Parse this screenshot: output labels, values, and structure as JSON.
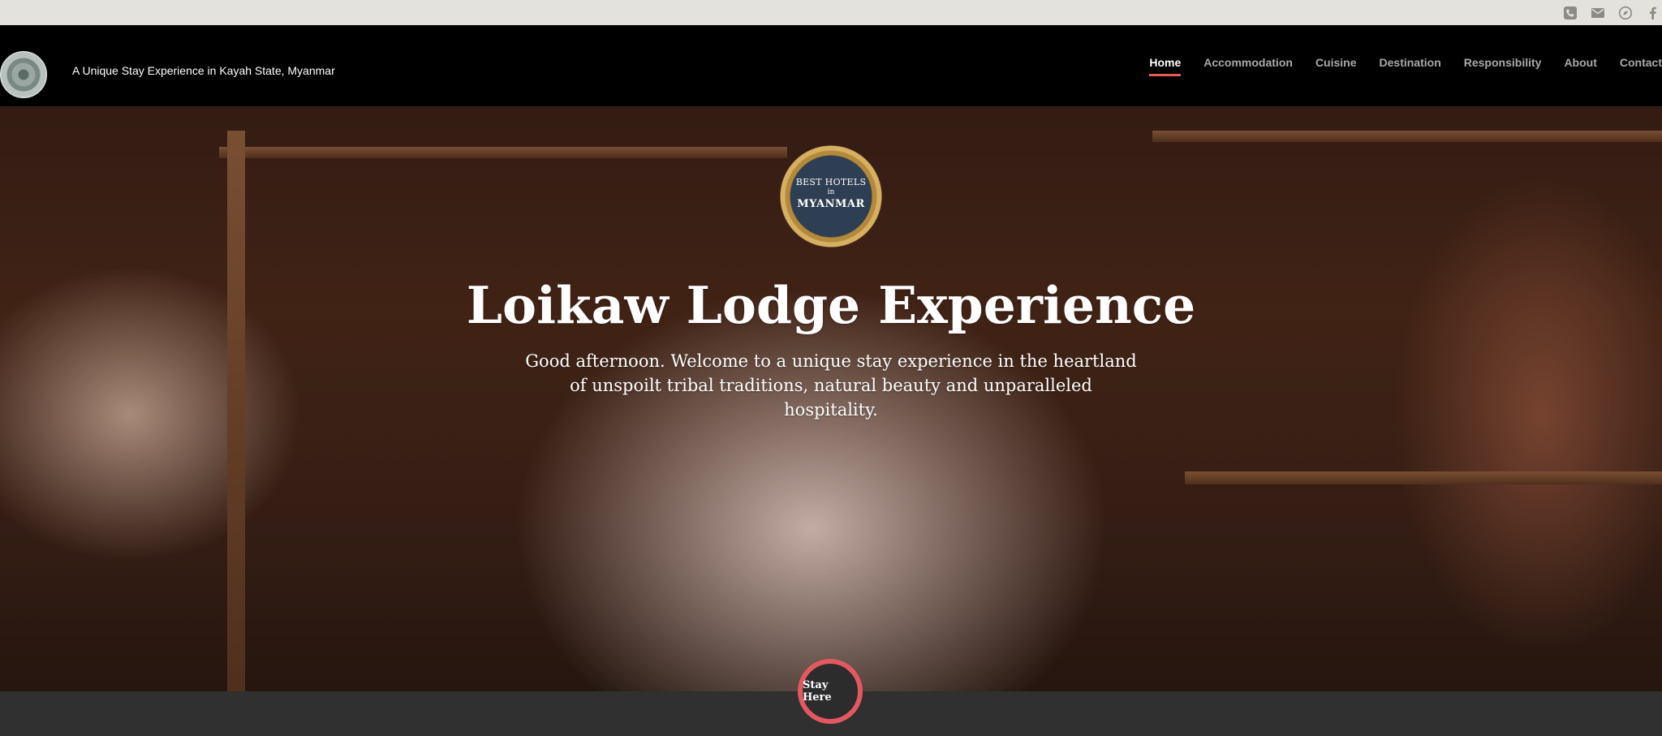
{
  "topbar": {
    "icons": [
      "phone-icon",
      "mail-icon",
      "compass-icon",
      "facebook-icon"
    ]
  },
  "header": {
    "tagline": "A Unique Stay Experience in Kayah State, Myanmar",
    "nav": [
      {
        "label": "Home",
        "active": true
      },
      {
        "label": "Accommodation",
        "active": false
      },
      {
        "label": "Cuisine",
        "active": false
      },
      {
        "label": "Destination",
        "active": false
      },
      {
        "label": "Responsibility",
        "active": false
      },
      {
        "label": "About",
        "active": false
      },
      {
        "label": "Contact",
        "active": false
      }
    ],
    "accent_color": "#e55a5a"
  },
  "hero": {
    "badge": {
      "line1": "BEST HOTELS",
      "line2": "in",
      "line3": "MYANMAR"
    },
    "title": "Loikaw Lodge Experience",
    "subtitle": "Good afternoon. Welcome to a unique stay experience in the heartland of unspoilt tribal traditions, natural beauty and unparalleled hospitality.",
    "cta_label": "Stay Here",
    "cta_color": "#e4585f"
  }
}
